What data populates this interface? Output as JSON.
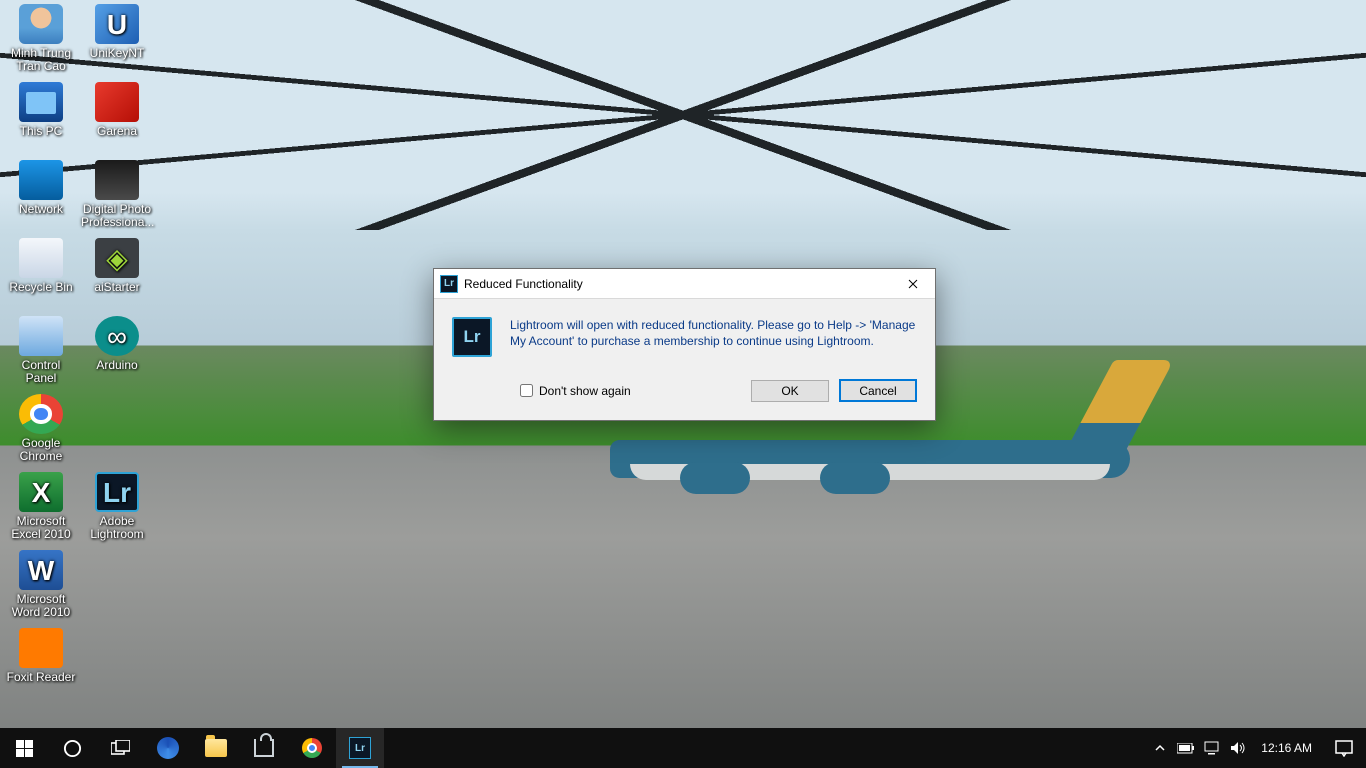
{
  "desktop_icons": {
    "col1": [
      {
        "label": "Minh Trung Tran Cao"
      },
      {
        "label": "This PC"
      },
      {
        "label": "Network"
      },
      {
        "label": "Recycle Bin"
      },
      {
        "label": "Control Panel"
      },
      {
        "label": "Google Chrome"
      },
      {
        "label": "Microsoft Excel 2010"
      },
      {
        "label": "Microsoft Word 2010"
      },
      {
        "label": "Foxit Reader"
      }
    ],
    "col2": [
      {
        "label": "UniKeyNT"
      },
      {
        "label": "Garena"
      },
      {
        "label": "Digital Photo Professiona..."
      },
      {
        "label": "aiStarter"
      },
      {
        "label": "Arduino"
      },
      {
        "label": "Adobe Lightroom"
      }
    ]
  },
  "dialog": {
    "app_icon_text": "Lr",
    "title": "Reduced Functionality",
    "message": "Lightroom will open with reduced functionality. Please go to Help -> 'Manage My Account' to purchase a membership to continue using Lightroom.",
    "dont_show_label": "Don't show again",
    "dont_show_checked": false,
    "ok_label": "OK",
    "cancel_label": "Cancel"
  },
  "taskbar": {
    "clock": "12:16 AM"
  }
}
